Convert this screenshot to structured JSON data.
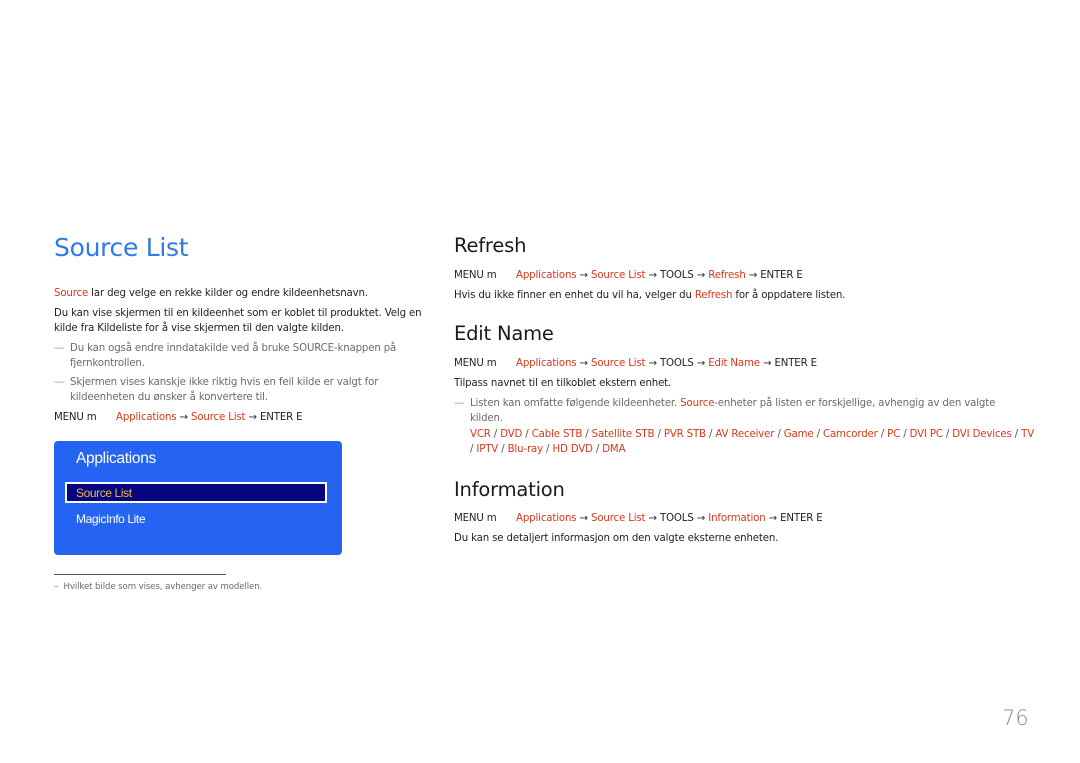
{
  "left": {
    "title": "Source List",
    "intro_highlight": "Source",
    "intro_rest": " lar deg velge en rekke kilder og endre kildeenhetsnavn.",
    "paragraph": "Du kan vise skjermen til en kildeenhet som er koblet til produktet. Velg en kilde fra Kildeliste for å vise skjermen til den valgte kilden.",
    "notes": [
      "Du kan også endre inndatakilde ved å bruke SOURCE-knappen på fjernkontrollen.",
      "Skjermen vises kanskje ikke riktig hvis en feil kilde er valgt for kildeenheten du ønsker å konvertere til."
    ],
    "menu_path": {
      "menu": "MENU m",
      "steps": [
        "Applications",
        "Source List"
      ],
      "enter": "ENTER E"
    },
    "panel": {
      "title": "Applications",
      "selected_item": "Source List",
      "items": [
        "MagicInfo Lite"
      ]
    },
    "footnote": "Hvilket bilde som vises, avhenger av modellen."
  },
  "right": {
    "refresh": {
      "title": "Refresh",
      "menu_path": {
        "menu": "MENU m",
        "steps": [
          "Applications",
          "Source List"
        ],
        "tools": "TOOLS",
        "action": "Refresh",
        "enter": "ENTER E"
      },
      "text_before": "Hvis du ikke finner en enhet du vil ha, velger du ",
      "text_highlight": "Refresh",
      "text_after": " for å oppdatere listen."
    },
    "edit_name": {
      "title": "Edit Name",
      "menu_path": {
        "menu": "MENU m",
        "steps": [
          "Applications",
          "Source List"
        ],
        "tools": "TOOLS",
        "action": "Edit Name",
        "enter": "ENTER E"
      },
      "text": "Tilpass navnet til en tilkoblet ekstern enhet.",
      "note_before": "Listen kan omfatte følgende kildeenheter. ",
      "note_highlight": "Source",
      "note_after": "-enheter på listen er forskjellige, avhengig av den valgte kilden.",
      "devices": [
        "VCR",
        "DVD",
        "Cable STB",
        "Satellite STB",
        "PVR STB",
        "AV Receiver",
        "Game",
        "Camcorder",
        "PC",
        "DVI PC",
        "DVI Devices",
        "TV",
        "IPTV",
        "Blu-ray",
        "HD DVD",
        "DMA"
      ]
    },
    "information": {
      "title": "Information",
      "menu_path": {
        "menu": "MENU m",
        "steps": [
          "Applications",
          "Source List"
        ],
        "tools": "TOOLS",
        "action": "Information",
        "enter": "ENTER E"
      },
      "text": "Du kan se detaljert informasjon om den valgte eksterne enheten."
    }
  },
  "page_number": "76",
  "colors": {
    "title_blue": "#2d7ae8",
    "highlight_red": "#d4391c",
    "panel_blue": "#2563f2",
    "panel_selected_bg": "#050580",
    "panel_selected_text": "#f0b93a"
  }
}
